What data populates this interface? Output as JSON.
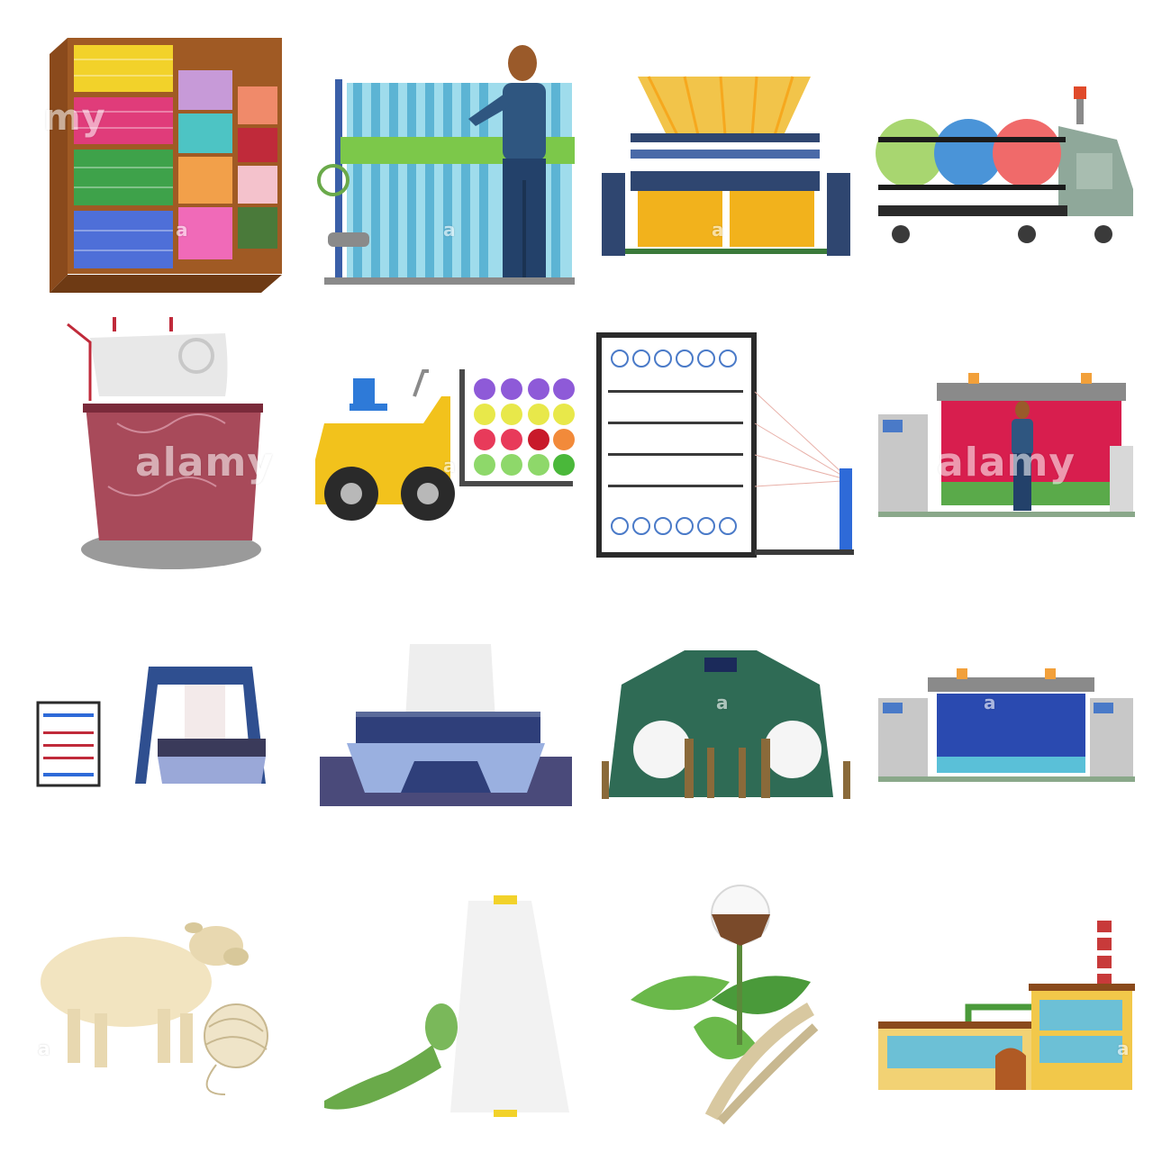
{
  "watermark": {
    "brand": "alamy",
    "partial_left": "my",
    "letter": "a"
  },
  "icons": [
    {
      "id": "fabric-shelf-icon"
    },
    {
      "id": "dyeing-machine-with-worker-icon"
    },
    {
      "id": "weaving-loom-icon"
    },
    {
      "id": "yarn-cart-vehicle-icon"
    },
    {
      "id": "sewing-machine-icon"
    },
    {
      "id": "spool-forklift-icon"
    },
    {
      "id": "warping-creel-rack-icon"
    },
    {
      "id": "printing-machine-with-worker-icon"
    },
    {
      "id": "creel-and-loom-icon"
    },
    {
      "id": "spinning-frame-icon"
    },
    {
      "id": "carding-machine-icon"
    },
    {
      "id": "industrial-loom-icon"
    },
    {
      "id": "sheep-with-yarn-icon"
    },
    {
      "id": "silkworm-and-thread-cone-icon"
    },
    {
      "id": "cotton-plant-icon"
    },
    {
      "id": "textile-factory-icon"
    }
  ],
  "colors": {
    "background": "#ffffff",
    "navy": "#2f4670",
    "worker_shirt": "#2f5680",
    "yellow": "#f2b21c",
    "green_machine": "#2f6b55",
    "factory_blue": "#6cc0d6"
  }
}
